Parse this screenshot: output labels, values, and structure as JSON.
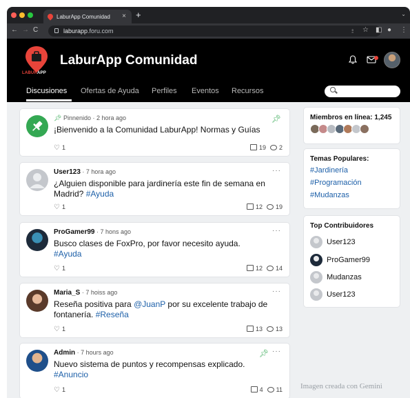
{
  "browser": {
    "tab_title": "LaburApp Comunidad",
    "url_host": "laburapp",
    "url_rest": ".foru.com"
  },
  "app": {
    "title": "LaburApp Comunidad",
    "logo_text_a": "LABUR",
    "logo_text_b": "APP"
  },
  "nav": {
    "tabs": [
      "Discusiones",
      "Ofertas de Ayuda",
      "Perfiles",
      "Eventos",
      "Recursos"
    ],
    "active_tab": "Discusiones"
  },
  "posts": [
    {
      "author": "",
      "meta": "Pinnenido · 2 hora ago",
      "title": "¡Bienvenido a la Comunidad LaburApp! Normas y Guías",
      "tag": "",
      "hearts": "1",
      "likes": "19",
      "comments": "2",
      "pinned": true
    },
    {
      "author": "User123",
      "meta": " · 7 hora ago",
      "title": "¿Alguien disponible para jardinería este fin de semana en Madrid?",
      "tag": "#Ayuda",
      "hearts": "1",
      "likes": "12",
      "comments": "19"
    },
    {
      "author": "ProGamer99",
      "meta": " · 7 hons ago",
      "title": "Busco clases de FoxPro, por favor necesito ayuda.",
      "tag": "#Ayuda",
      "hearts": "1",
      "likes": "12",
      "comments": "14"
    },
    {
      "author": "Maria_S",
      "meta": " · 7 hoiss ago",
      "title_a": "Reseña positiva para ",
      "mention": "@JuanP",
      "title_b": " por su excelente trabajo de fontanería.",
      "tag": "#Reseña",
      "hearts": "1",
      "likes": "13",
      "comments": "13"
    },
    {
      "author": "Admin",
      "meta": " · 7 hours ago",
      "title": "Nuevo sistema de puntos y recompensas explicado.",
      "tag": "#Anuncio",
      "hearts": "1",
      "likes": "4",
      "comments": "11",
      "pinned": true
    }
  ],
  "sidebar": {
    "online_label": "Miembros en línea: 1,245",
    "popular_title": "Temas Populares:",
    "topics": [
      "#Jardinería",
      "#Programación",
      "#Mudanzas"
    ],
    "contrib_title": "Top Contribuidores",
    "contributors": [
      "User123",
      "ProGamer99",
      "Mudanzas",
      "User123"
    ]
  },
  "watermark": "Imagen creada con Gemini",
  "icons": {
    "pin": "pin-icon",
    "bell": "bell-icon",
    "mail": "mail-icon",
    "search": "search-icon"
  },
  "colors": {
    "accent_red": "#e8443a",
    "pin_green": "#34a853",
    "link_blue": "#1c5fa8",
    "header_bg": "#000000"
  }
}
